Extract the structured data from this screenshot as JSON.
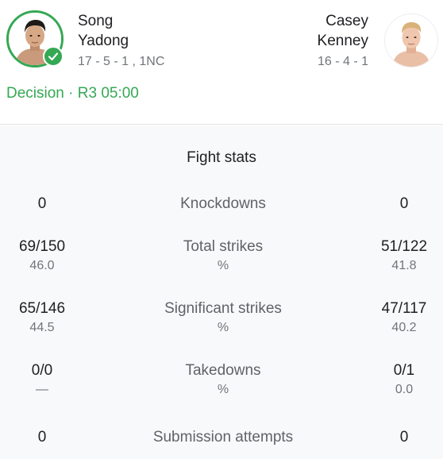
{
  "fighters": {
    "left": {
      "first_name": "Song",
      "last_name": "Yadong",
      "record": "17 - 5 - 1 , 1NC",
      "winner": true
    },
    "right": {
      "first_name": "Casey",
      "last_name": "Kenney",
      "record": "16 - 4 - 1"
    }
  },
  "result": {
    "method": "Decision",
    "separator": "·",
    "time": "R3 05:00"
  },
  "stats": {
    "title": "Fight stats",
    "rows": [
      {
        "label": "Knockdowns",
        "unit": "",
        "left": "0",
        "left_sub": "",
        "right": "0",
        "right_sub": ""
      },
      {
        "label": "Total strikes",
        "unit": "%",
        "left": "69/150",
        "left_sub": "46.0",
        "right": "51/122",
        "right_sub": "41.8"
      },
      {
        "label": "Significant strikes",
        "unit": "%",
        "left": "65/146",
        "left_sub": "44.5",
        "right": "47/117",
        "right_sub": "40.2"
      },
      {
        "label": "Takedowns",
        "unit": "%",
        "left": "0/0",
        "left_sub": "—",
        "right": "0/1",
        "right_sub": "0.0"
      },
      {
        "label": "Submission attempts",
        "unit": "",
        "left": "0",
        "left_sub": "",
        "right": "0",
        "right_sub": ""
      }
    ]
  },
  "colors": {
    "winner_green": "#34a853",
    "text_primary": "#202124",
    "text_secondary": "#70757a",
    "stats_background": "#f8f9fa"
  },
  "icons": {
    "winner_badge": "checkmark-icon"
  }
}
